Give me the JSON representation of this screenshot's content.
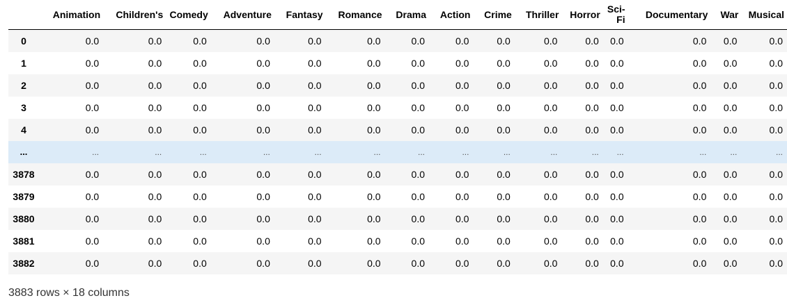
{
  "dataframe": {
    "index_header": "",
    "columns": [
      "Animation",
      "Children's",
      "Comedy",
      "Adventure",
      "Fantasy",
      "Romance",
      "Drama",
      "Action",
      "Crime",
      "Thriller",
      "Horror",
      "Sci-Fi",
      "Documentary",
      "War",
      "Musical"
    ],
    "rows": [
      {
        "index": "0",
        "values": [
          "0.0",
          "0.0",
          "0.0",
          "0.0",
          "0.0",
          "0.0",
          "0.0",
          "0.0",
          "0.0",
          "0.0",
          "0.0",
          "0.0",
          "0.0",
          "0.0",
          "0.0"
        ]
      },
      {
        "index": "1",
        "values": [
          "0.0",
          "0.0",
          "0.0",
          "0.0",
          "0.0",
          "0.0",
          "0.0",
          "0.0",
          "0.0",
          "0.0",
          "0.0",
          "0.0",
          "0.0",
          "0.0",
          "0.0"
        ]
      },
      {
        "index": "2",
        "values": [
          "0.0",
          "0.0",
          "0.0",
          "0.0",
          "0.0",
          "0.0",
          "0.0",
          "0.0",
          "0.0",
          "0.0",
          "0.0",
          "0.0",
          "0.0",
          "0.0",
          "0.0"
        ]
      },
      {
        "index": "3",
        "values": [
          "0.0",
          "0.0",
          "0.0",
          "0.0",
          "0.0",
          "0.0",
          "0.0",
          "0.0",
          "0.0",
          "0.0",
          "0.0",
          "0.0",
          "0.0",
          "0.0",
          "0.0"
        ]
      },
      {
        "index": "4",
        "values": [
          "0.0",
          "0.0",
          "0.0",
          "0.0",
          "0.0",
          "0.0",
          "0.0",
          "0.0",
          "0.0",
          "0.0",
          "0.0",
          "0.0",
          "0.0",
          "0.0",
          "0.0"
        ]
      },
      {
        "index": "...",
        "values": [
          "...",
          "...",
          "...",
          "...",
          "...",
          "...",
          "...",
          "...",
          "...",
          "...",
          "...",
          "...",
          "...",
          "...",
          "..."
        ],
        "ellipsis": true
      },
      {
        "index": "3878",
        "values": [
          "0.0",
          "0.0",
          "0.0",
          "0.0",
          "0.0",
          "0.0",
          "0.0",
          "0.0",
          "0.0",
          "0.0",
          "0.0",
          "0.0",
          "0.0",
          "0.0",
          "0.0"
        ]
      },
      {
        "index": "3879",
        "values": [
          "0.0",
          "0.0",
          "0.0",
          "0.0",
          "0.0",
          "0.0",
          "0.0",
          "0.0",
          "0.0",
          "0.0",
          "0.0",
          "0.0",
          "0.0",
          "0.0",
          "0.0"
        ]
      },
      {
        "index": "3880",
        "values": [
          "0.0",
          "0.0",
          "0.0",
          "0.0",
          "0.0",
          "0.0",
          "0.0",
          "0.0",
          "0.0",
          "0.0",
          "0.0",
          "0.0",
          "0.0",
          "0.0",
          "0.0"
        ]
      },
      {
        "index": "3881",
        "values": [
          "0.0",
          "0.0",
          "0.0",
          "0.0",
          "0.0",
          "0.0",
          "0.0",
          "0.0",
          "0.0",
          "0.0",
          "0.0",
          "0.0",
          "0.0",
          "0.0",
          "0.0"
        ]
      },
      {
        "index": "3882",
        "values": [
          "0.0",
          "0.0",
          "0.0",
          "0.0",
          "0.0",
          "0.0",
          "0.0",
          "0.0",
          "0.0",
          "0.0",
          "0.0",
          "0.0",
          "0.0",
          "0.0",
          "0.0"
        ]
      }
    ],
    "shape_text": "3883 rows × 18 columns"
  },
  "colors": {
    "row_stripe": "#f5f5f5",
    "row_hover_highlight": "#dcebf8",
    "header_rule": "#000000"
  }
}
